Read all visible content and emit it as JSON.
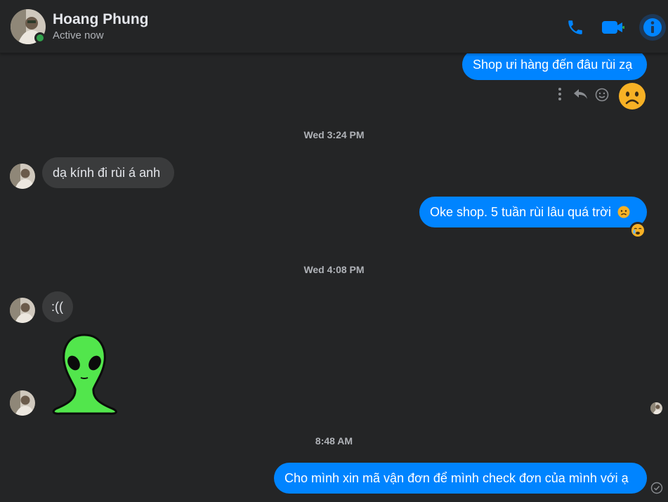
{
  "header": {
    "name": "Hoang Phung",
    "status": "Active now",
    "icons": [
      "phone-icon",
      "video-camera-icon",
      "info-icon"
    ],
    "accent_color": "#0084ff"
  },
  "messages": {
    "m1": "Shop ưi hàng đến đâu rùi zạ",
    "ts1": "Wed 3:24 PM",
    "m2": "dạ kính đi rùi á anh",
    "m3": "Oke shop. 5 tuần rùi lâu quá trời",
    "ts2": "Wed 4:08 PM",
    "m4": ":((",
    "ts3": "8:48 AM",
    "m5": "Cho mình xin mã vận đơn để mình check đơn của mình với ạ"
  },
  "message_actions": [
    "more-icon",
    "reply-icon",
    "react-icon"
  ],
  "sticker": "green-alien-sticker",
  "colors": {
    "background": "#242526",
    "incoming_bubble": "#3a3b3c",
    "outgoing_bubble": "#0084ff",
    "online": "#31a24c"
  }
}
